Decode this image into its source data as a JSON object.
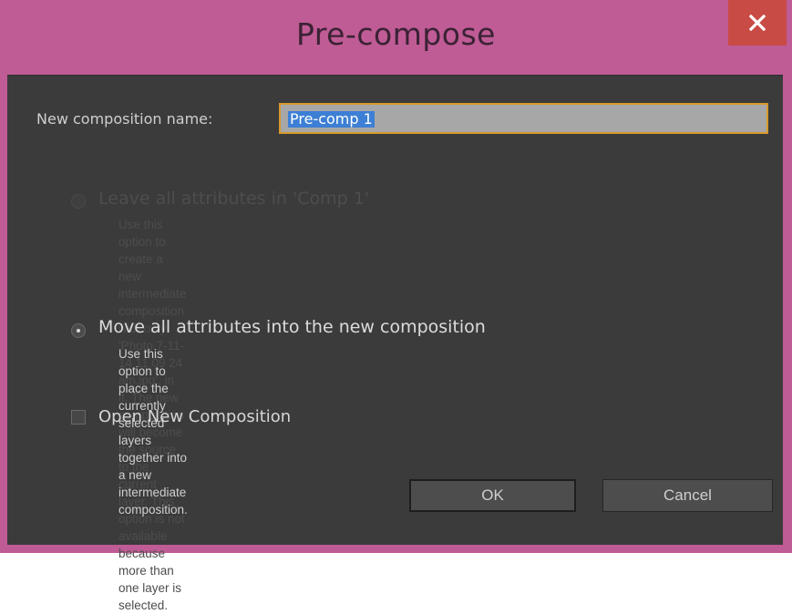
{
  "window": {
    "title": "Pre-compose",
    "close_icon": "close-icon"
  },
  "name_field": {
    "label": "New composition name:",
    "value": "Pre-comp 1"
  },
  "options": [
    {
      "title": "Leave all attributes in 'Comp 1'",
      "description_lines": [
        "Use this option to create a new intermediate composition with only 'Photo 7-11-",
        "14 11 09 24 am.jpg', in it. The new composition will become the source to the",
        "current layer. This option is not available because more than one layer is",
        "selected."
      ],
      "enabled": false,
      "selected": false
    },
    {
      "title": "Move all attributes into the new composition",
      "description_lines": [
        "Use this option to place the currently selected layers together into a new",
        "intermediate composition."
      ],
      "enabled": true,
      "selected": true
    }
  ],
  "open_new_composition": {
    "label": "Open New Composition",
    "checked": false
  },
  "buttons": {
    "ok": "OK",
    "cancel": "Cancel"
  },
  "colors": {
    "frame_accent": "#bf5b95",
    "close_button": "#c94b46",
    "client_bg": "#3b3b3b",
    "focus_border": "#d79a2b",
    "selection": "#3d7fd4"
  }
}
